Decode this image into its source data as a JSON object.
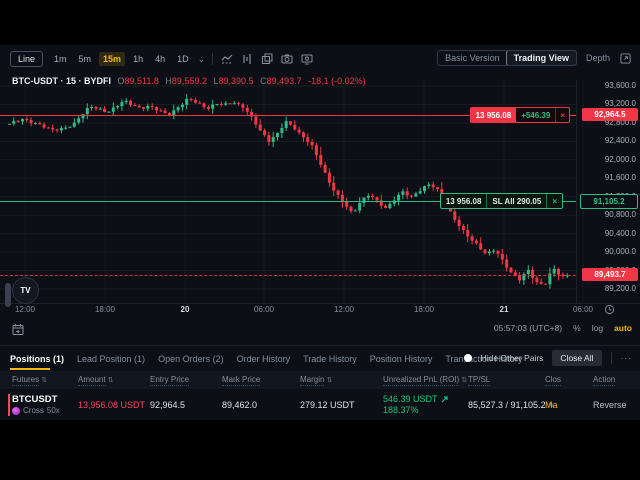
{
  "toolbar": {
    "line_label": "Line",
    "intervals": [
      {
        "label": "1m",
        "active": false
      },
      {
        "label": "5m",
        "active": false
      },
      {
        "label": "15m",
        "active": true
      },
      {
        "label": "1h",
        "active": false
      },
      {
        "label": "4h",
        "active": false
      },
      {
        "label": "1D",
        "active": false
      }
    ],
    "chevron_glyph": "⌄",
    "basic_version": "Basic Version",
    "trading_view": "Trading View",
    "depth": "Depth"
  },
  "symbol_row": {
    "title": "BTC-USDT · 15 · BYDFI",
    "o_label": "O",
    "o": "89,511.8",
    "h_label": "H",
    "h": "89,559.2",
    "l_label": "L",
    "l": "89,390.5",
    "c_label": "C",
    "c": "89,493.7",
    "change": "-18.1 (-0.02%)"
  },
  "chart_data": {
    "type": "candlestick",
    "symbol": "BTC-USDT",
    "interval": "15",
    "exchange": "BYDFI",
    "ohlc": {
      "open": 89511.8,
      "high": 89559.2,
      "low": 89390.5,
      "close": 89493.7,
      "change": -18.1,
      "change_pct": -0.02
    },
    "y_tick_values": [
      93600,
      93200,
      92800,
      92400,
      92000,
      91600,
      91200,
      90800,
      90400,
      90000,
      89600,
      89200
    ],
    "x_ticks": [
      {
        "label": "12:00",
        "major": false
      },
      {
        "label": "18:00",
        "major": false
      },
      {
        "label": "20",
        "major": true
      },
      {
        "label": "06:00",
        "major": false
      },
      {
        "label": "12:00",
        "major": false
      },
      {
        "label": "18:00",
        "major": false
      },
      {
        "label": "21",
        "major": true
      },
      {
        "label": "06:00",
        "major": false
      }
    ],
    "price_range": [
      89100,
      93750
    ],
    "levels": {
      "entry": 92964.5,
      "stop": 91105.2,
      "last": 89493.7
    },
    "candle_count": 130,
    "up_color": "#2ebd85",
    "down_color": "#f23645",
    "price_path": [
      [
        0.0,
        92780
      ],
      [
        0.025,
        92880
      ],
      [
        0.05,
        92780
      ],
      [
        0.075,
        92640
      ],
      [
        0.1,
        92700
      ],
      [
        0.115,
        92760
      ],
      [
        0.13,
        92980
      ],
      [
        0.145,
        93180
      ],
      [
        0.16,
        93100
      ],
      [
        0.175,
        93010
      ],
      [
        0.19,
        93150
      ],
      [
        0.205,
        93300
      ],
      [
        0.22,
        93180
      ],
      [
        0.235,
        93100
      ],
      [
        0.25,
        93180
      ],
      [
        0.27,
        93060
      ],
      [
        0.285,
        92950
      ],
      [
        0.3,
        93120
      ],
      [
        0.32,
        93330
      ],
      [
        0.34,
        93200
      ],
      [
        0.355,
        93120
      ],
      [
        0.37,
        93230
      ],
      [
        0.385,
        93180
      ],
      [
        0.4,
        93250
      ],
      [
        0.42,
        93150
      ],
      [
        0.435,
        92900
      ],
      [
        0.45,
        92620
      ],
      [
        0.465,
        92420
      ],
      [
        0.48,
        92560
      ],
      [
        0.495,
        92820
      ],
      [
        0.51,
        92700
      ],
      [
        0.525,
        92520
      ],
      [
        0.54,
        92350
      ],
      [
        0.555,
        91980
      ],
      [
        0.57,
        91600
      ],
      [
        0.585,
        91280
      ],
      [
        0.6,
        91050
      ],
      [
        0.615,
        90820
      ],
      [
        0.63,
        91120
      ],
      [
        0.645,
        91250
      ],
      [
        0.66,
        91080
      ],
      [
        0.675,
        90950
      ],
      [
        0.69,
        91150
      ],
      [
        0.705,
        91300
      ],
      [
        0.72,
        91180
      ],
      [
        0.735,
        91340
      ],
      [
        0.75,
        91470
      ],
      [
        0.765,
        91380
      ],
      [
        0.78,
        91100
      ],
      [
        0.795,
        90780
      ],
      [
        0.81,
        90500
      ],
      [
        0.825,
        90300
      ],
      [
        0.84,
        90150
      ],
      [
        0.855,
        89950
      ],
      [
        0.87,
        90050
      ],
      [
        0.885,
        89800
      ],
      [
        0.9,
        89550
      ],
      [
        0.915,
        89400
      ],
      [
        0.93,
        89600
      ],
      [
        0.945,
        89350
      ],
      [
        0.96,
        89300
      ],
      [
        0.975,
        89650
      ],
      [
        0.99,
        89450
      ],
      [
        1.0,
        89493.7
      ]
    ]
  },
  "overlays": {
    "entry_badge": {
      "amount": "13 956.08",
      "pnl": "+546.39",
      "close": "×",
      "axis": "92,964.5"
    },
    "sl_badge": {
      "amount": "13 956.08",
      "sl": "SL All 290.05",
      "close": "×",
      "axis": "91,105.2"
    },
    "last_badge": {
      "axis": "89,493.7"
    },
    "tv_logo": "TV"
  },
  "clock_row": {
    "time": "05:57:03 (UTC+8)",
    "percent": "%",
    "log": "log",
    "auto": "auto"
  },
  "tabs": [
    {
      "label": "Positions (1)",
      "active": true
    },
    {
      "label": "Lead Position (1)",
      "active": false
    },
    {
      "label": "Open Orders (2)",
      "active": false
    },
    {
      "label": "Order History",
      "active": false
    },
    {
      "label": "Trade History",
      "active": false
    },
    {
      "label": "Position History",
      "active": false
    },
    {
      "label": "Transaction History",
      "active": false
    }
  ],
  "tabs_right": {
    "hide_other_pairs": "Hide Other Pairs",
    "close_all": "Close All",
    "more": "···"
  },
  "table": {
    "sort_glyph": "⇅",
    "headers": [
      {
        "label": "Futures",
        "sort": true
      },
      {
        "label": "Amount",
        "sort": true
      },
      {
        "label": "Entry Price",
        "sort": false
      },
      {
        "label": "Mark Price",
        "sort": false
      },
      {
        "label": "Margin",
        "sort": true
      },
      {
        "label": "Unrealized PnL (ROI)",
        "sort": true
      },
      {
        "label": "TP/SL",
        "sort": false
      },
      {
        "label": "Clos",
        "sort": false
      },
      {
        "label": "Action",
        "sort": false
      }
    ],
    "row": {
      "symbol": "BTCUSDT",
      "mode": "Cross",
      "leverage": "50x",
      "amount": "13,956.08 USDT",
      "entry_price": "92,964.5",
      "mark_price": "89,462.0",
      "margin": "279.12 USDT",
      "pnl": "546.39 USDT",
      "roi": "188.37%",
      "tpsl": "85,527.3 / 91,105.2",
      "pencil_glyph": "✎",
      "clos": "Ma",
      "action": "Reverse"
    }
  }
}
